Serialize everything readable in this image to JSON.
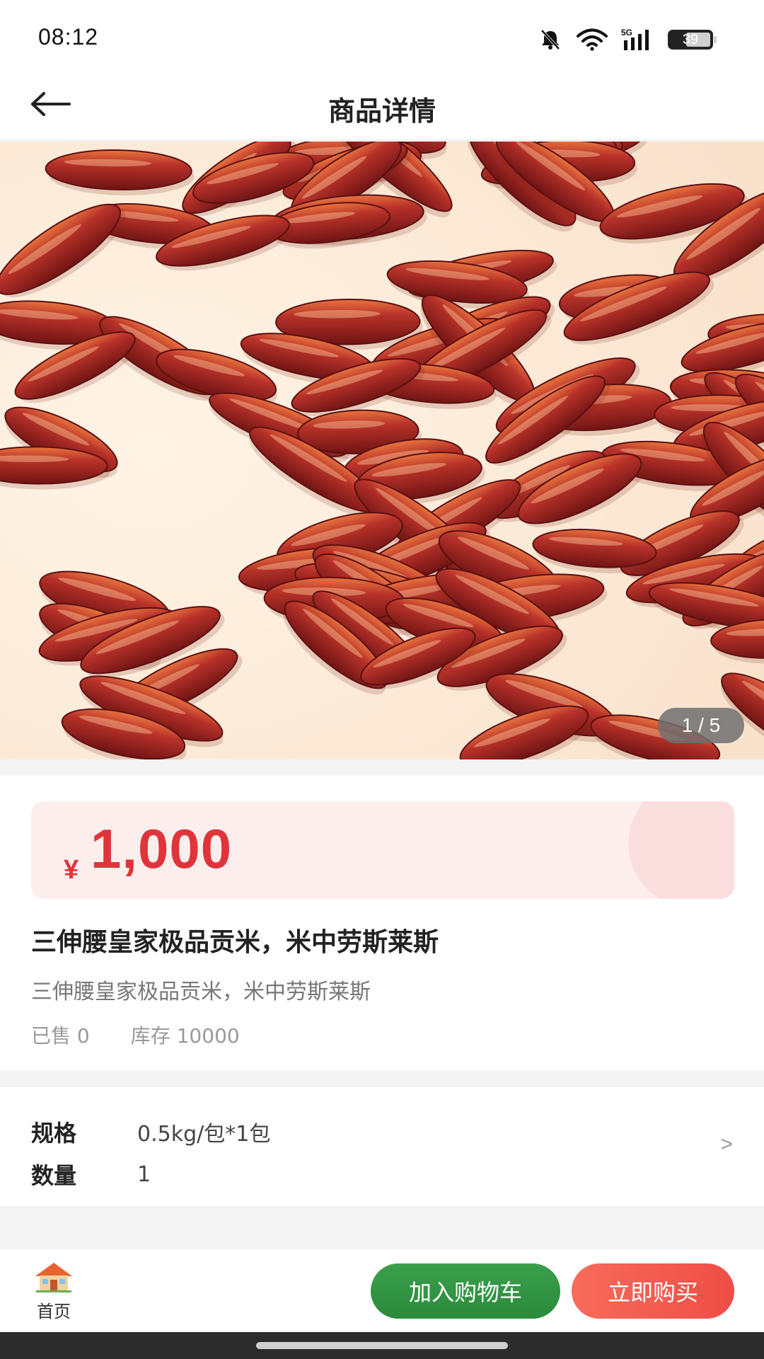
{
  "status_bar": {
    "time": "08:12",
    "network": "5G",
    "battery": "39",
    "icons": [
      "bell-muted-icon",
      "wifi-icon",
      "signal-5g-icon",
      "battery-icon"
    ]
  },
  "header": {
    "title": "商品详情",
    "back_icon": "arrow-left-icon"
  },
  "gallery": {
    "counter": "1 / 5",
    "current": 1,
    "total": 5
  },
  "product": {
    "price_symbol": "¥",
    "price": "1,000",
    "title": "三伸腰皇家极品贡米，米中劳斯莱斯",
    "subtitle": "三伸腰皇家极品贡米，米中劳斯莱斯",
    "sold": "已售 0",
    "stock": "库存 10000"
  },
  "spec": {
    "spec_label": "规格",
    "spec_value": "0.5kg/包*1包",
    "qty_label": "数量",
    "qty_value": "1",
    "chevron": ">"
  },
  "bottom_bar": {
    "home_label": "首页",
    "home_icon": "house-icon",
    "cart_label": "加入购物车",
    "buy_label": "立即购买"
  },
  "colors": {
    "price": "#e0343a",
    "price_bg": "#fdeeee",
    "cart_button": "#2b8a3c",
    "buy_button": "#ef4d46"
  }
}
